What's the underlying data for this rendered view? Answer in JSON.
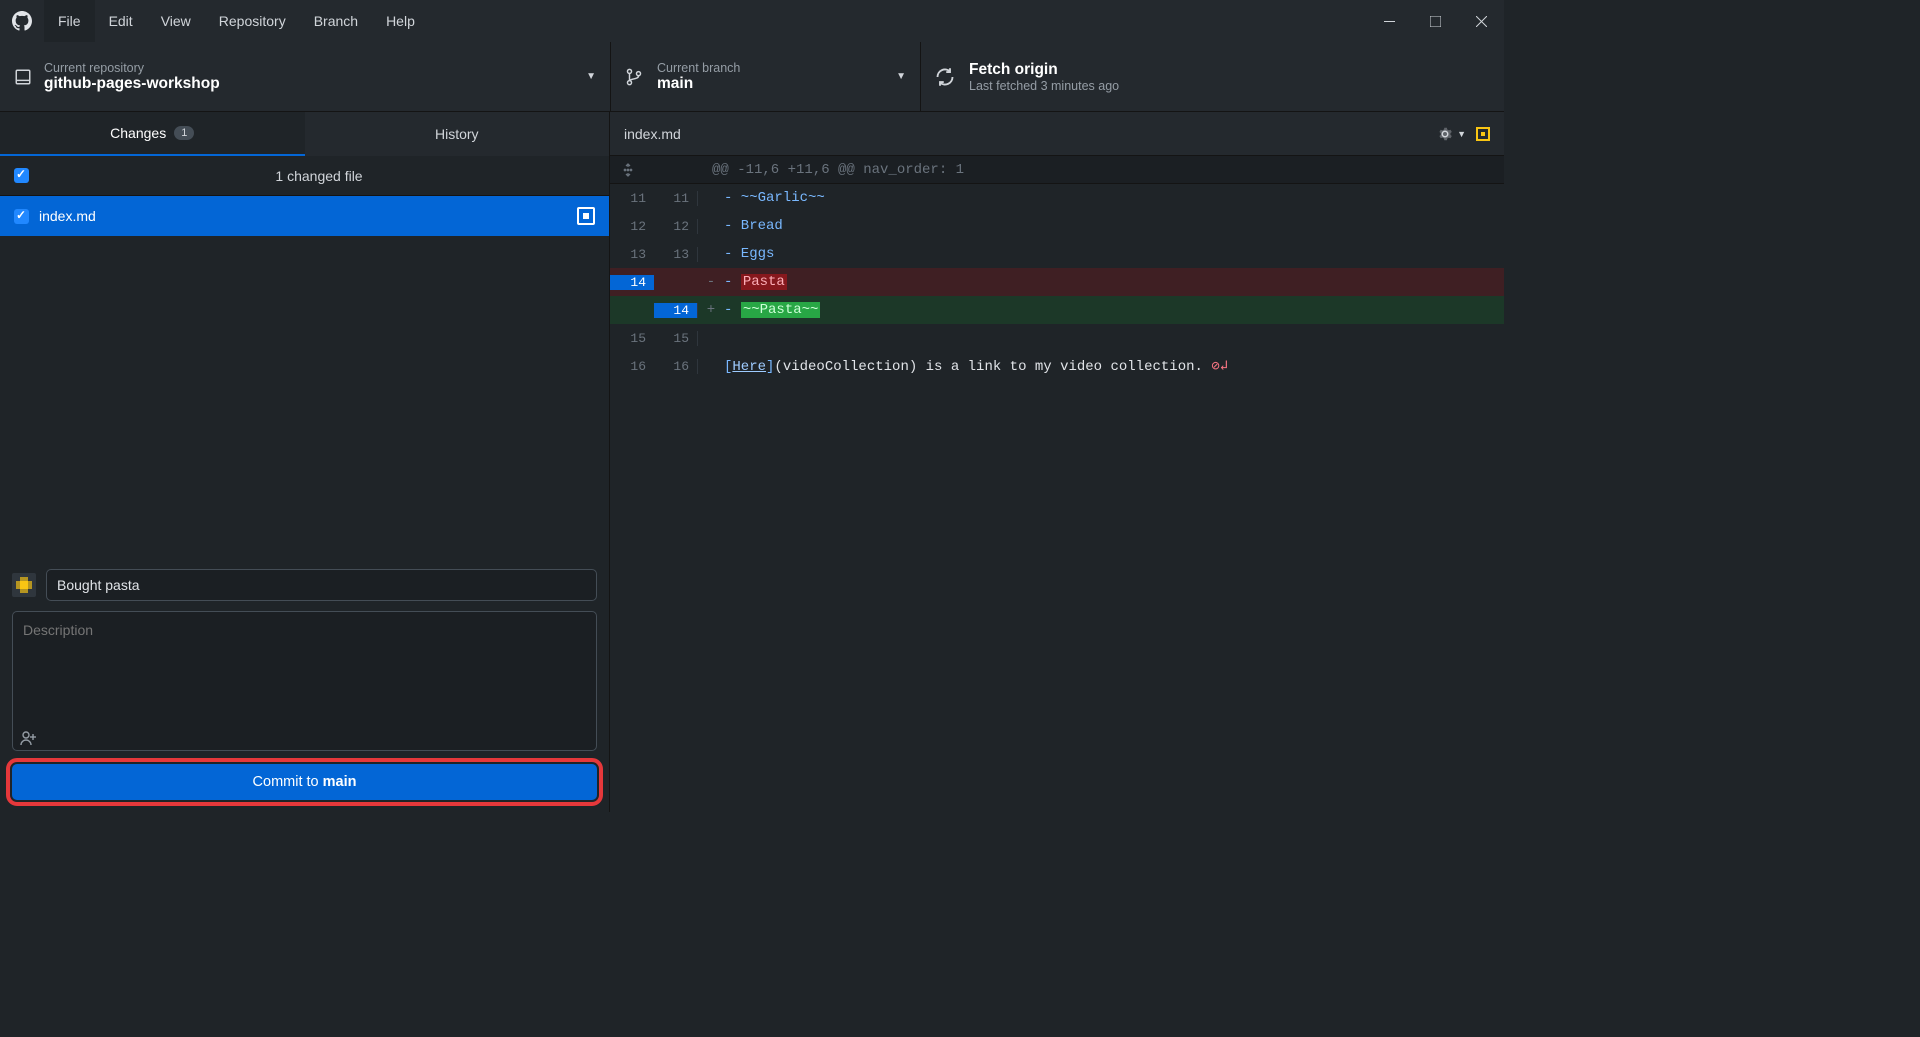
{
  "menu": [
    "File",
    "Edit",
    "View",
    "Repository",
    "Branch",
    "Help"
  ],
  "menu_active": 0,
  "repo": {
    "label": "Current repository",
    "name": "github-pages-workshop"
  },
  "branch": {
    "label": "Current branch",
    "name": "main"
  },
  "fetch": {
    "label": "Fetch origin",
    "sub": "Last fetched 3 minutes ago"
  },
  "left_tabs": {
    "changes": "Changes",
    "changes_count": "1",
    "history": "History"
  },
  "files": {
    "header": "1 changed file",
    "items": [
      "index.md"
    ]
  },
  "commit": {
    "summary_value": "Bought pasta",
    "description_placeholder": "Description",
    "button_prefix": "Commit to ",
    "button_branch": "main"
  },
  "diff": {
    "filename": "index.md",
    "hunk": "@@ -11,6 +11,6 @@ nav_order: 1",
    "lines": [
      {
        "type": "ctx",
        "old": "11",
        "new": "11",
        "sign": "",
        "prefix": "- ",
        "text": "~~Garlic~~"
      },
      {
        "type": "ctx",
        "old": "12",
        "new": "12",
        "sign": "",
        "prefix": "- ",
        "text": "Bread"
      },
      {
        "type": "ctx",
        "old": "13",
        "new": "13",
        "sign": "",
        "prefix": "- ",
        "text": "Eggs"
      },
      {
        "type": "del",
        "old": "14",
        "new": "",
        "sign": "-",
        "prefix": "- ",
        "text": "Pasta"
      },
      {
        "type": "add",
        "old": "",
        "new": "14",
        "sign": "+",
        "prefix": "- ",
        "text": "~~Pasta~~"
      },
      {
        "type": "ctx",
        "old": "15",
        "new": "15",
        "sign": "",
        "prefix": "",
        "text": ""
      },
      {
        "type": "link",
        "old": "16",
        "new": "16",
        "sign": "",
        "link_text": "Here",
        "link_target": "videoCollection",
        "tail": " is a link to my video collection."
      }
    ]
  }
}
